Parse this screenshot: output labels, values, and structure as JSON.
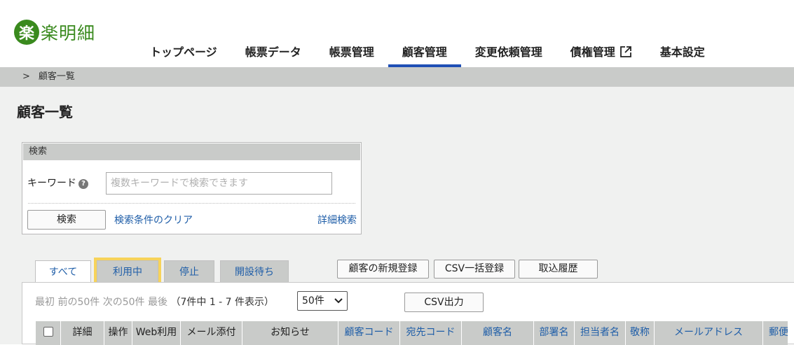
{
  "header": {
    "logo_mark": "楽",
    "logo_text": "楽明細",
    "nav": [
      {
        "label": "トップページ",
        "active": false
      },
      {
        "label": "帳票データ",
        "active": false
      },
      {
        "label": "帳票管理",
        "active": false
      },
      {
        "label": "顧客管理",
        "active": true
      },
      {
        "label": "変更依頼管理",
        "active": false
      },
      {
        "label": "債権管理",
        "active": false,
        "icon": "external-link-icon"
      },
      {
        "label": "基本設定",
        "active": false
      }
    ]
  },
  "breadcrumb": {
    "separator": ">",
    "current": "顧客一覧"
  },
  "page": {
    "title": "顧客一覧"
  },
  "search": {
    "heading": "検索",
    "keyword_label": "キーワード",
    "help_icon": "?",
    "keyword_placeholder": "複数キーワードで検索できます",
    "keyword_value": "",
    "search_button": "検索",
    "clear_link": "検索条件のクリア",
    "detail_link": "詳細検索"
  },
  "tabs": [
    {
      "label": "すべて",
      "active": true
    },
    {
      "label": "利用中",
      "active": false,
      "highlighted": true
    },
    {
      "label": "停止",
      "active": false
    },
    {
      "label": "開設待ち",
      "active": false
    }
  ],
  "actions": {
    "new_customer": "顧客の新規登録",
    "csv_bulk": "CSV一括登録",
    "import_history": "取込履歴"
  },
  "pager": {
    "first": "最初",
    "prev": "前の50件",
    "next": "次の50件",
    "last": "最後",
    "count_text": "（7件中 1 - 7 件表示）",
    "per_page": "50件"
  },
  "csv_output": "CSV出力",
  "table": {
    "columns": [
      "詳細",
      "操作",
      "Web利用",
      "メール添付",
      "お知らせ",
      "顧客コード",
      "宛先コード",
      "顧客名",
      "部署名",
      "担当者名",
      "敬称",
      "メールアドレス",
      "郵便"
    ]
  },
  "colors": {
    "brand": "#3a8a1e",
    "accent": "#1f4fb5",
    "link": "#1f5ea8",
    "highlight": "#f7d35a"
  }
}
